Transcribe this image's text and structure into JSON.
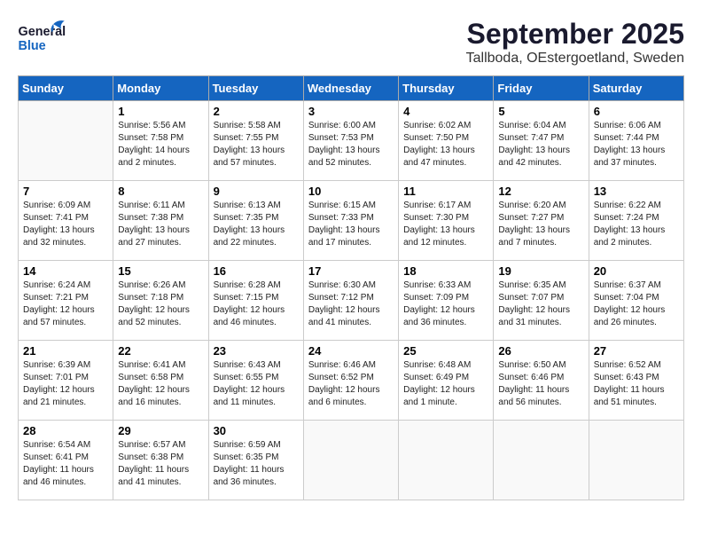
{
  "header": {
    "logo_line1": "General",
    "logo_line2": "Blue",
    "title": "September 2025",
    "subtitle": "Tallboda, OEstergoetland, Sweden"
  },
  "calendar": {
    "days_of_week": [
      "Sunday",
      "Monday",
      "Tuesday",
      "Wednesday",
      "Thursday",
      "Friday",
      "Saturday"
    ],
    "weeks": [
      [
        {
          "day": "",
          "info": ""
        },
        {
          "day": "1",
          "info": "Sunrise: 5:56 AM\nSunset: 7:58 PM\nDaylight: 14 hours\nand 2 minutes."
        },
        {
          "day": "2",
          "info": "Sunrise: 5:58 AM\nSunset: 7:55 PM\nDaylight: 13 hours\nand 57 minutes."
        },
        {
          "day": "3",
          "info": "Sunrise: 6:00 AM\nSunset: 7:53 PM\nDaylight: 13 hours\nand 52 minutes."
        },
        {
          "day": "4",
          "info": "Sunrise: 6:02 AM\nSunset: 7:50 PM\nDaylight: 13 hours\nand 47 minutes."
        },
        {
          "day": "5",
          "info": "Sunrise: 6:04 AM\nSunset: 7:47 PM\nDaylight: 13 hours\nand 42 minutes."
        },
        {
          "day": "6",
          "info": "Sunrise: 6:06 AM\nSunset: 7:44 PM\nDaylight: 13 hours\nand 37 minutes."
        }
      ],
      [
        {
          "day": "7",
          "info": "Sunrise: 6:09 AM\nSunset: 7:41 PM\nDaylight: 13 hours\nand 32 minutes."
        },
        {
          "day": "8",
          "info": "Sunrise: 6:11 AM\nSunset: 7:38 PM\nDaylight: 13 hours\nand 27 minutes."
        },
        {
          "day": "9",
          "info": "Sunrise: 6:13 AM\nSunset: 7:35 PM\nDaylight: 13 hours\nand 22 minutes."
        },
        {
          "day": "10",
          "info": "Sunrise: 6:15 AM\nSunset: 7:33 PM\nDaylight: 13 hours\nand 17 minutes."
        },
        {
          "day": "11",
          "info": "Sunrise: 6:17 AM\nSunset: 7:30 PM\nDaylight: 13 hours\nand 12 minutes."
        },
        {
          "day": "12",
          "info": "Sunrise: 6:20 AM\nSunset: 7:27 PM\nDaylight: 13 hours\nand 7 minutes."
        },
        {
          "day": "13",
          "info": "Sunrise: 6:22 AM\nSunset: 7:24 PM\nDaylight: 13 hours\nand 2 minutes."
        }
      ],
      [
        {
          "day": "14",
          "info": "Sunrise: 6:24 AM\nSunset: 7:21 PM\nDaylight: 12 hours\nand 57 minutes."
        },
        {
          "day": "15",
          "info": "Sunrise: 6:26 AM\nSunset: 7:18 PM\nDaylight: 12 hours\nand 52 minutes."
        },
        {
          "day": "16",
          "info": "Sunrise: 6:28 AM\nSunset: 7:15 PM\nDaylight: 12 hours\nand 46 minutes."
        },
        {
          "day": "17",
          "info": "Sunrise: 6:30 AM\nSunset: 7:12 PM\nDaylight: 12 hours\nand 41 minutes."
        },
        {
          "day": "18",
          "info": "Sunrise: 6:33 AM\nSunset: 7:09 PM\nDaylight: 12 hours\nand 36 minutes."
        },
        {
          "day": "19",
          "info": "Sunrise: 6:35 AM\nSunset: 7:07 PM\nDaylight: 12 hours\nand 31 minutes."
        },
        {
          "day": "20",
          "info": "Sunrise: 6:37 AM\nSunset: 7:04 PM\nDaylight: 12 hours\nand 26 minutes."
        }
      ],
      [
        {
          "day": "21",
          "info": "Sunrise: 6:39 AM\nSunset: 7:01 PM\nDaylight: 12 hours\nand 21 minutes."
        },
        {
          "day": "22",
          "info": "Sunrise: 6:41 AM\nSunset: 6:58 PM\nDaylight: 12 hours\nand 16 minutes."
        },
        {
          "day": "23",
          "info": "Sunrise: 6:43 AM\nSunset: 6:55 PM\nDaylight: 12 hours\nand 11 minutes."
        },
        {
          "day": "24",
          "info": "Sunrise: 6:46 AM\nSunset: 6:52 PM\nDaylight: 12 hours\nand 6 minutes."
        },
        {
          "day": "25",
          "info": "Sunrise: 6:48 AM\nSunset: 6:49 PM\nDaylight: 12 hours\nand 1 minute."
        },
        {
          "day": "26",
          "info": "Sunrise: 6:50 AM\nSunset: 6:46 PM\nDaylight: 11 hours\nand 56 minutes."
        },
        {
          "day": "27",
          "info": "Sunrise: 6:52 AM\nSunset: 6:43 PM\nDaylight: 11 hours\nand 51 minutes."
        }
      ],
      [
        {
          "day": "28",
          "info": "Sunrise: 6:54 AM\nSunset: 6:41 PM\nDaylight: 11 hours\nand 46 minutes."
        },
        {
          "day": "29",
          "info": "Sunrise: 6:57 AM\nSunset: 6:38 PM\nDaylight: 11 hours\nand 41 minutes."
        },
        {
          "day": "30",
          "info": "Sunrise: 6:59 AM\nSunset: 6:35 PM\nDaylight: 11 hours\nand 36 minutes."
        },
        {
          "day": "",
          "info": ""
        },
        {
          "day": "",
          "info": ""
        },
        {
          "day": "",
          "info": ""
        },
        {
          "day": "",
          "info": ""
        }
      ]
    ]
  }
}
